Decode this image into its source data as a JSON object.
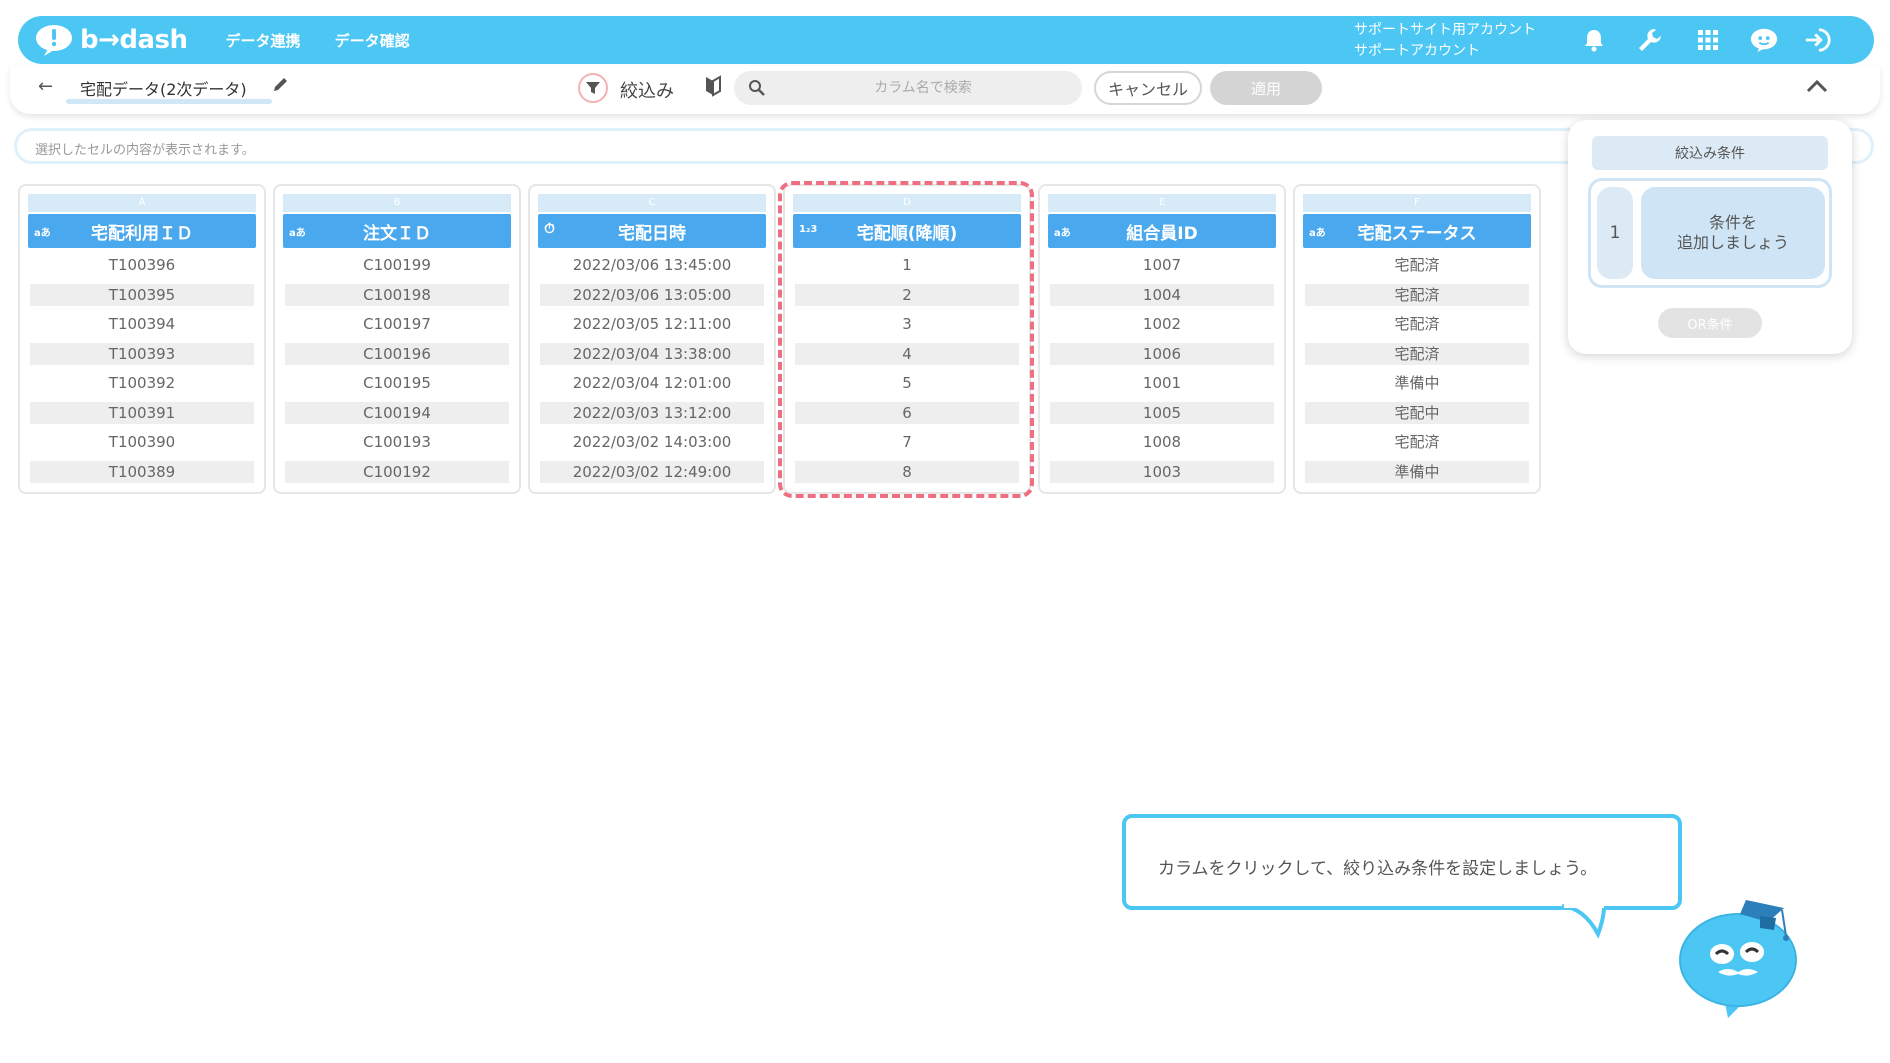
{
  "header": {
    "logo_text": "b→dash",
    "nav": [
      "データ連携",
      "データ確認"
    ],
    "account_line1": "サポートサイト用アカウント",
    "account_line2": "サポートアカウント",
    "icons": [
      "bell-icon",
      "wrench-icon",
      "grid-icon",
      "mascot-icon",
      "logout-icon"
    ]
  },
  "subbar": {
    "back_symbol": "←",
    "title": "宅配データ(2次データ)",
    "filter_label": "絞込み",
    "search_placeholder": "カラム名で検索",
    "cancel_label": "キャンセル",
    "apply_label": "適用"
  },
  "cellbar": {
    "placeholder": "選択したセルの内容が表示されます。"
  },
  "columns": [
    {
      "letter": "A",
      "type": "aあ",
      "name": "宅配利用ＩＤ",
      "values": [
        "T100396",
        "T100395",
        "T100394",
        "T100393",
        "T100392",
        "T100391",
        "T100390",
        "T100389"
      ]
    },
    {
      "letter": "B",
      "type": "aあ",
      "name": "注文ＩＤ",
      "values": [
        "C100199",
        "C100198",
        "C100197",
        "C100196",
        "C100195",
        "C100194",
        "C100193",
        "C100192"
      ]
    },
    {
      "letter": "C",
      "type": "⏱",
      "name": "宅配日時",
      "values": [
        "2022/03/06 13:45:00",
        "2022/03/06 13:05:00",
        "2022/03/05 12:11:00",
        "2022/03/04 13:38:00",
        "2022/03/04 12:01:00",
        "2022/03/03 13:12:00",
        "2022/03/02 14:03:00",
        "2022/03/02 12:49:00"
      ]
    },
    {
      "letter": "D",
      "type": "1₂3",
      "name": "宅配順(降順)",
      "values": [
        "1",
        "2",
        "3",
        "4",
        "5",
        "6",
        "7",
        "8"
      ]
    },
    {
      "letter": "E",
      "type": "aあ",
      "name": "組合員ID",
      "values": [
        "1007",
        "1004",
        "1002",
        "1006",
        "1001",
        "1005",
        "1008",
        "1003"
      ]
    },
    {
      "letter": "F",
      "type": "aあ",
      "name": "宅配ステータス",
      "values": [
        "宅配済",
        "宅配済",
        "宅配済",
        "宅配済",
        "準備中",
        "宅配中",
        "宅配済",
        "準備中"
      ]
    }
  ],
  "panel": {
    "title": "絞込み条件",
    "cond_number": "1",
    "add_line1": "条件を",
    "add_line2": "追加しましょう",
    "or_label": "OR条件"
  },
  "bubble": {
    "text": "カラムをクリックして、絞り込み条件を設定しましょう。"
  },
  "colors": {
    "brand": "#4cc7f4",
    "column_header": "#4aa8ee",
    "highlight": "#ef6f82"
  }
}
